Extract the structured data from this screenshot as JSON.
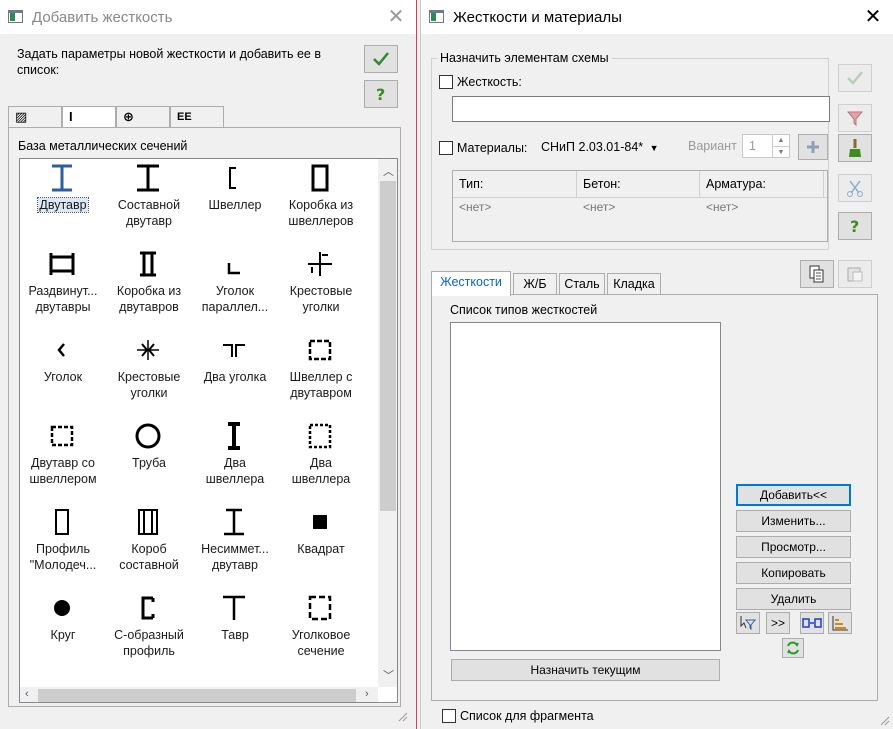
{
  "left_window": {
    "title": "Добавить жесткость",
    "close_glyph": "✕",
    "instruction": "Задать параметры новой жесткости и добавить ее в список:",
    "tabs": [
      {
        "icon": "hatched-square-icon",
        "glyph": "▨",
        "active": false
      },
      {
        "icon": "i-beam-icon",
        "glyph": "I",
        "active": true
      },
      {
        "icon": "grid-circle-icon",
        "glyph": "⊕",
        "active": false
      },
      {
        "icon": "composite-section-icon",
        "glyph": "ΕΕ",
        "active": false
      }
    ],
    "library_title": "База металлических сечений",
    "sections": [
      [
        "Двутавр"
      ],
      [
        "Составной",
        "двутавр"
      ],
      [
        "Швеллер"
      ],
      [
        "Коробка из",
        "швеллеров"
      ],
      [
        "Раздвинут...",
        "двутавры"
      ],
      [
        "Коробка из",
        "двутавров"
      ],
      [
        "Уголок",
        "параллел..."
      ],
      [
        "Крестовые",
        "уголки"
      ],
      [
        "Уголок"
      ],
      [
        "Крестовые",
        "уголки"
      ],
      [
        "Два уголка"
      ],
      [
        "Швеллер с",
        "двутавром"
      ],
      [
        "Двутавр со",
        "швеллером"
      ],
      [
        "Труба"
      ],
      [
        "Два",
        "швеллера"
      ],
      [
        "Два",
        "швеллера"
      ],
      [
        "Профиль",
        "\"Молодеч..."
      ],
      [
        "Короб",
        "составной"
      ],
      [
        "Несиммет...",
        "двутавр"
      ],
      [
        "Квадрат"
      ],
      [
        "Круг"
      ],
      [
        "С-образный",
        "профиль"
      ],
      [
        "Тавр"
      ],
      [
        "Уголковое",
        "сечение"
      ]
    ],
    "selected_index": 0
  },
  "right_window": {
    "title": "Жесткости и материалы",
    "close_glyph": "✕",
    "assign_group": "Назначить элементам схемы",
    "stiffness_label": "Жесткость:",
    "stiffness_value": "",
    "materials_label": "Материалы:",
    "norm": "СНиП 2.03.01-84*",
    "variant_label": "Вариант",
    "variant_value": "1",
    "material_columns": [
      {
        "header": "Тип:",
        "value": "<нет>"
      },
      {
        "header": "Бетон:",
        "value": "<нет>"
      },
      {
        "header": "Арматура:",
        "value": "<нет>"
      }
    ],
    "tabs": [
      "Жесткости",
      "Ж/Б",
      "Сталь",
      "Кладка"
    ],
    "active_tab": 0,
    "list_title": "Список типов жесткостей",
    "buttons": {
      "add": "Добавить<<",
      "edit": "Изменить...",
      "view": "Просмотр...",
      "copy": "Копировать",
      "delete": "Удалить",
      "assign_current": "Назначить текущим",
      "expand": ">>"
    },
    "fragment_label": "Список для фрагмента"
  },
  "colors": {
    "accent": "#0078d7",
    "ok_green": "#2e8b2e",
    "help_green": "#3c8c1e",
    "selected_tab_text": "#0b62c4"
  }
}
